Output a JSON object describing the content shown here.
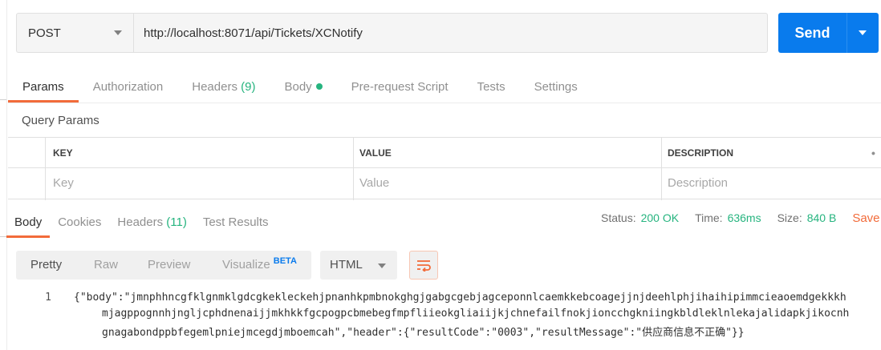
{
  "request": {
    "method": "POST",
    "url": "http://localhost:8071/api/Tickets/XCNotify",
    "send_label": "Send"
  },
  "request_tabs": [
    {
      "label": "Params",
      "active": true
    },
    {
      "label": "Authorization"
    },
    {
      "label": "Headers",
      "count": "(9)"
    },
    {
      "label": "Body",
      "indicator": "green-dot"
    },
    {
      "label": "Pre-request Script"
    },
    {
      "label": "Tests"
    },
    {
      "label": "Settings"
    }
  ],
  "query_params": {
    "title": "Query Params",
    "columns": [
      "KEY",
      "VALUE",
      "DESCRIPTION"
    ],
    "placeholders": {
      "key": "Key",
      "value": "Value",
      "description": "Description"
    },
    "more_icon": "ellipsis-icon"
  },
  "response_tabs": [
    {
      "label": "Body",
      "active": true
    },
    {
      "label": "Cookies"
    },
    {
      "label": "Headers",
      "count": "(11)"
    },
    {
      "label": "Test Results"
    }
  ],
  "response_meta": {
    "status_label": "Status:",
    "status_value": "200 OK",
    "time_label": "Time:",
    "time_value": "636ms",
    "size_label": "Size:",
    "size_value": "840 B",
    "save_label": "Save"
  },
  "body_toolbar": {
    "formats": [
      "Pretty",
      "Raw",
      "Preview",
      "Visualize"
    ],
    "beta": "BETA",
    "language": "HTML",
    "wrap_icon": "wrap-lines-icon"
  },
  "code": {
    "line_number": "1",
    "line1": "{\"body\":\"jmnphhncgfklgnmklgdcgkekleckehjpnanhkpmbnokghgjgabgcgebjagceponnlcaemkkebcoagejjnjdeehlphjihaihipimmcieaoemdgekkkh",
    "line2": "mjagppognnhjngljcphdnenaijjmkhkkfgcpogpcbmebegfmpfliieokgliaiijkjchnefailfnokjioncchgkniingkbldleklnlekajalidapkjikocnh",
    "line3": "gnagabondppbfegemlpniejmcegdjmboemcah\",\"header\":{\"resultCode\":\"0003\",\"resultMessage\":\"供应商信息不正确\"}}"
  },
  "colors": {
    "accent": "#f26b3a",
    "send": "#097bed",
    "success": "#26b47f"
  }
}
